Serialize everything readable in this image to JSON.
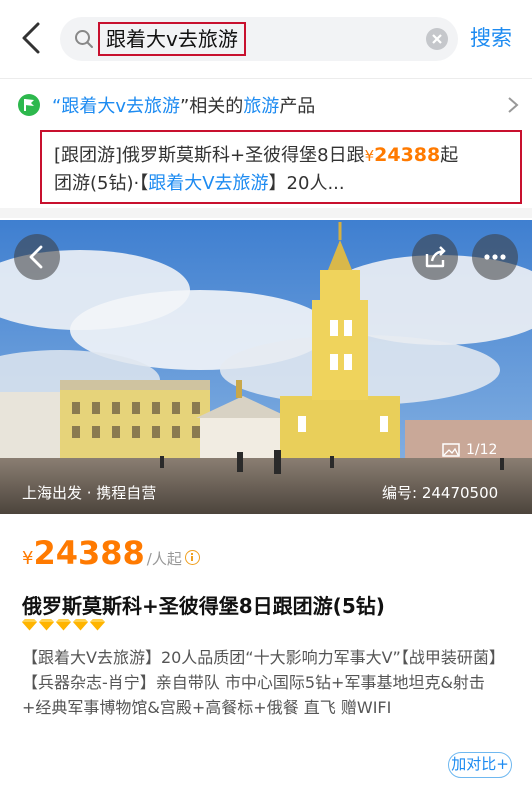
{
  "header": {
    "search_query": "跟着大v去旅游",
    "search_button": "搜索"
  },
  "related": {
    "quote_open": "“",
    "keyword": "跟着大v去旅游",
    "quote_close": "”相关的",
    "category": "旅游",
    "suffix": "产品"
  },
  "product_link": {
    "prefix": "[跟团游]俄罗斯莫斯科+圣彼得堡8日跟",
    "currency": "¥",
    "price": "24388",
    "price_suffix": "起",
    "line2_start": "团游(5钻)·【",
    "highlight": "跟着大V去旅游",
    "line2_end": "】20人..."
  },
  "hero": {
    "departure": "上海出发 · 携程自营",
    "id_label": "编号: 24470500",
    "image_counter": "1/12"
  },
  "price": {
    "currency": "¥",
    "amount": "24388",
    "unit": "/人起"
  },
  "product": {
    "title": "俄罗斯莫斯科+圣彼得堡8日跟团游(5钻)",
    "diamond_count": 5,
    "description": "【跟着大V去旅游】20人品质团“十大影响力军事大V”【战甲装研菌】【兵器杂志-肖宁】亲自带队 市中心国际5钻+军事基地坦克&射击+经典军事博物馆&宫殿+高餐标+俄餐 直飞 赠WIFI"
  },
  "compare_button": "加对比+",
  "colors": {
    "accent_blue": "#1d8bf1",
    "price_orange": "#ff7a00",
    "highlight_red": "#c8102e"
  }
}
